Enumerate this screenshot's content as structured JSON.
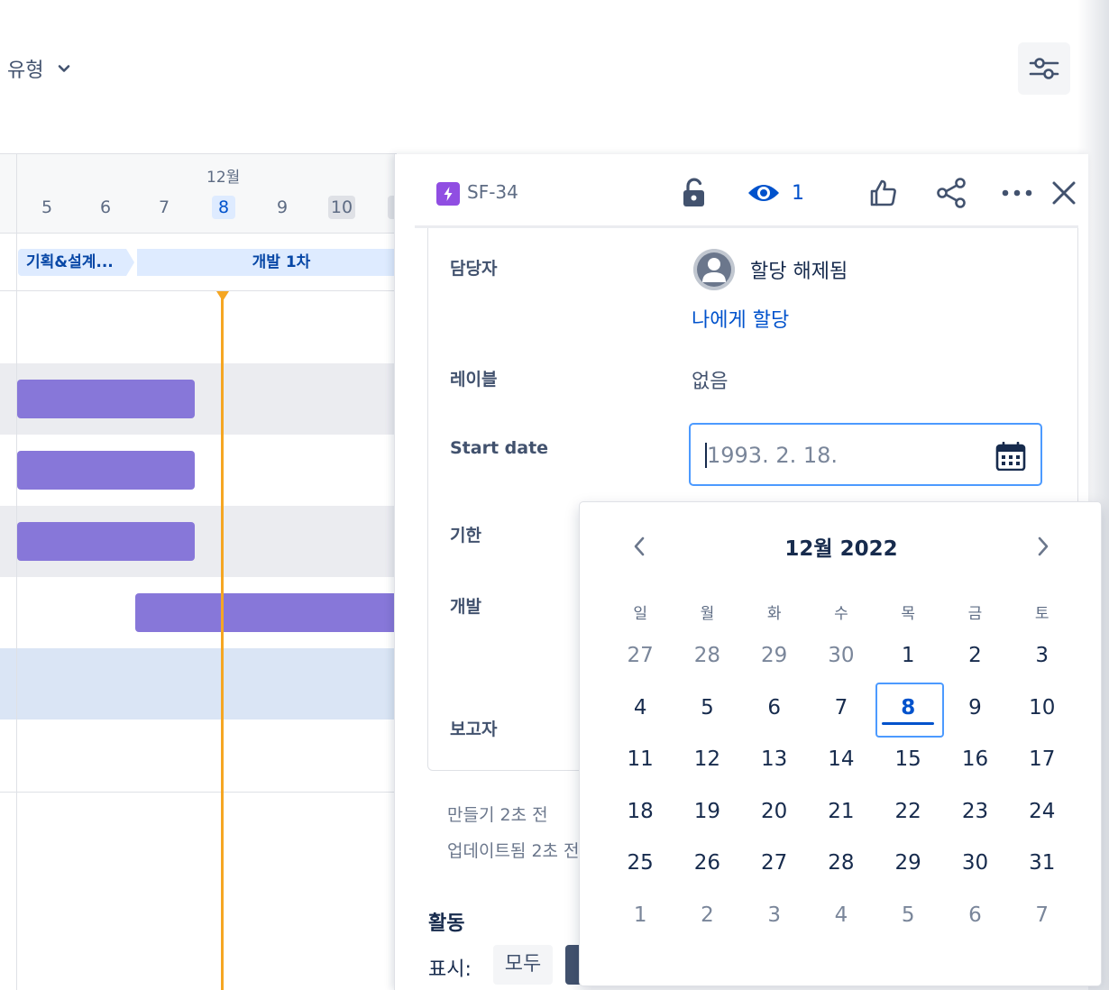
{
  "toolbar": {
    "type_filter_label": "유형"
  },
  "timeline": {
    "month_label": "12월",
    "days": [
      {
        "label": "5",
        "state": "normal"
      },
      {
        "label": "6",
        "state": "normal"
      },
      {
        "label": "7",
        "state": "normal"
      },
      {
        "label": "8",
        "state": "today"
      },
      {
        "label": "9",
        "state": "normal"
      },
      {
        "label": "10",
        "state": "weekend"
      }
    ],
    "sprints": [
      {
        "label": "기획&설계..."
      },
      {
        "label": "개발 1차"
      }
    ],
    "today_marker_color": "#f5a623",
    "bar_color": "#8777d9"
  },
  "issue": {
    "key": "SF-34",
    "watch_count": "1",
    "fields": {
      "assignee_label": "담당자",
      "assignee_value": "할당 해제됨",
      "assign_me_label": "나에게 할당",
      "labels_label": "레이블",
      "labels_value": "없음",
      "start_date_label": "Start date",
      "start_date_placeholder": "1993. 2. 18.",
      "due_label": "기한",
      "dev_label": "개발",
      "reporter_label": "보고자"
    },
    "created": "만들기 2초 전",
    "updated": "업데이트됨 2초 전",
    "activity": {
      "title": "활동",
      "show_label": "표시:",
      "filter_all": "모두"
    }
  },
  "datepicker": {
    "title": "12월 2022",
    "weekdays": [
      "일",
      "월",
      "화",
      "수",
      "목",
      "금",
      "토"
    ],
    "weeks": [
      [
        {
          "d": "27",
          "m": true
        },
        {
          "d": "28",
          "m": true
        },
        {
          "d": "29",
          "m": true
        },
        {
          "d": "30",
          "m": true
        },
        {
          "d": "1"
        },
        {
          "d": "2"
        },
        {
          "d": "3"
        }
      ],
      [
        {
          "d": "4"
        },
        {
          "d": "5"
        },
        {
          "d": "6"
        },
        {
          "d": "7"
        },
        {
          "d": "8",
          "s": true
        },
        {
          "d": "9"
        },
        {
          "d": "10"
        }
      ],
      [
        {
          "d": "11"
        },
        {
          "d": "12"
        },
        {
          "d": "13"
        },
        {
          "d": "14"
        },
        {
          "d": "15"
        },
        {
          "d": "16"
        },
        {
          "d": "17"
        }
      ],
      [
        {
          "d": "18"
        },
        {
          "d": "19"
        },
        {
          "d": "20"
        },
        {
          "d": "21"
        },
        {
          "d": "22"
        },
        {
          "d": "23"
        },
        {
          "d": "24"
        }
      ],
      [
        {
          "d": "25"
        },
        {
          "d": "26"
        },
        {
          "d": "27"
        },
        {
          "d": "28"
        },
        {
          "d": "29"
        },
        {
          "d": "30"
        },
        {
          "d": "31"
        }
      ],
      [
        {
          "d": "1",
          "m": true
        },
        {
          "d": "2",
          "m": true
        },
        {
          "d": "3",
          "m": true
        },
        {
          "d": "4",
          "m": true
        },
        {
          "d": "5",
          "m": true
        },
        {
          "d": "6",
          "m": true
        },
        {
          "d": "7",
          "m": true
        }
      ]
    ]
  }
}
